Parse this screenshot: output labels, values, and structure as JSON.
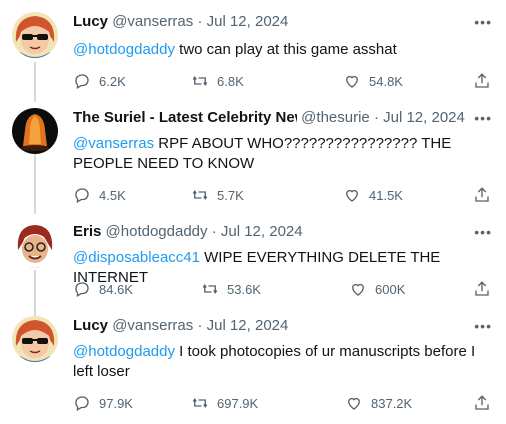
{
  "tweets": [
    {
      "name": "Lucy",
      "handle": "@vanserras",
      "separator": "·",
      "date": "Jul 12, 2024",
      "mention": "@hotdogdaddy",
      "text": " two can play at this game asshat",
      "replies": "6.2K",
      "retweets": "6.8K",
      "likes": "54.8K"
    },
    {
      "name": "The Suriel - Latest Celebrity New",
      "handle": "@thesurie",
      "separator": "·",
      "date": "Jul 12, 2024",
      "mention": "@vanserras",
      "text": " RPF ABOUT WHO???????????????? THE PEOPLE NEED TO KNOW",
      "replies": "4.5K",
      "retweets": "5.7K",
      "likes": "41.5K"
    },
    {
      "name": "Eris",
      "handle": "@hotdogdaddy",
      "separator": "·",
      "date": "Jul 12, 2024",
      "mention": "@disposableacc41",
      "text": " WIPE EVERYTHING DELETE THE INTERNET",
      "replies": "84.6K",
      "retweets": "53.6K",
      "likes": "600K"
    },
    {
      "name": "Lucy",
      "handle": "@vanserras",
      "separator": "·",
      "date": "Jul 12, 2024",
      "mention": "@hotdogdaddy",
      "text": " I took photocopies of ur manuscripts before I left loser",
      "replies": "97.9K",
      "retweets": "697.9K",
      "likes": "837.2K"
    }
  ],
  "icons": {
    "reply": "reply-icon",
    "retweet": "retweet-icon",
    "like": "heart-icon",
    "share": "share-icon",
    "more": "more-icon"
  },
  "colors": {
    "link": "#1d9bf0",
    "muted": "#536471",
    "text": "#0f1419",
    "thread": "#cfd9de"
  }
}
